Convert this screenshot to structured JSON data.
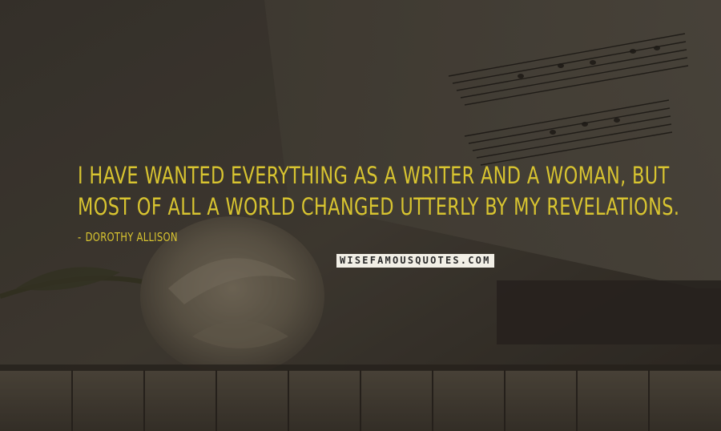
{
  "quote": {
    "lines": [
      "I have wanted everything as a writer and a woman, but",
      "most of all a world changed utterly by my revelations."
    ]
  },
  "author": {
    "dash": "-",
    "name": "Dorothy Allison"
  },
  "watermark": {
    "text": "WISEFAMOUSQUOTES.COM"
  },
  "colors": {
    "quote_text": "#d8c430",
    "background": "#3a342c",
    "watermark_bg": "#f2efe6"
  }
}
